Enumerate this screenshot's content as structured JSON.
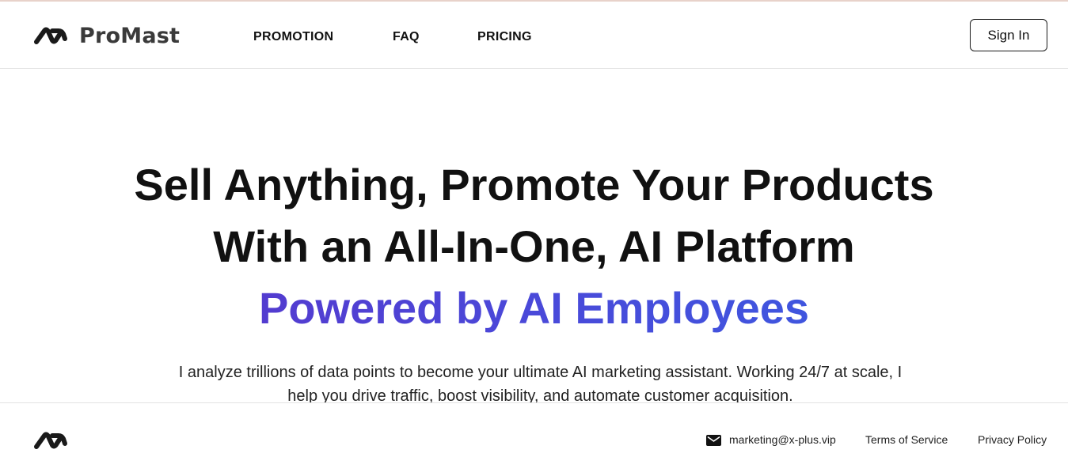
{
  "brand": {
    "name": "ProMast",
    "logo_icon": "promast-logo-icon"
  },
  "nav": {
    "items": [
      {
        "label": "PROMOTION"
      },
      {
        "label": "FAQ"
      },
      {
        "label": "PRICING"
      }
    ]
  },
  "header": {
    "signin_label": "Sign In"
  },
  "hero": {
    "line1": "Sell Anything, Promote Your Products",
    "line2": "With an All-In-One, AI Platform",
    "line3": "Powered by AI Employees",
    "description": "I analyze trillions of data points to become your ultimate AI marketing assistant. Working 24/7 at scale, I help you drive traffic, boost visibility, and automate customer acquisition."
  },
  "footer": {
    "email": "marketing@x-plus.vip",
    "email_icon": "mail-icon",
    "terms": "Terms of Service",
    "privacy": "Privacy Policy"
  },
  "colors": {
    "gradient_start": "#5b2fc7",
    "gradient_end": "#3561e4",
    "text": "#111111"
  }
}
